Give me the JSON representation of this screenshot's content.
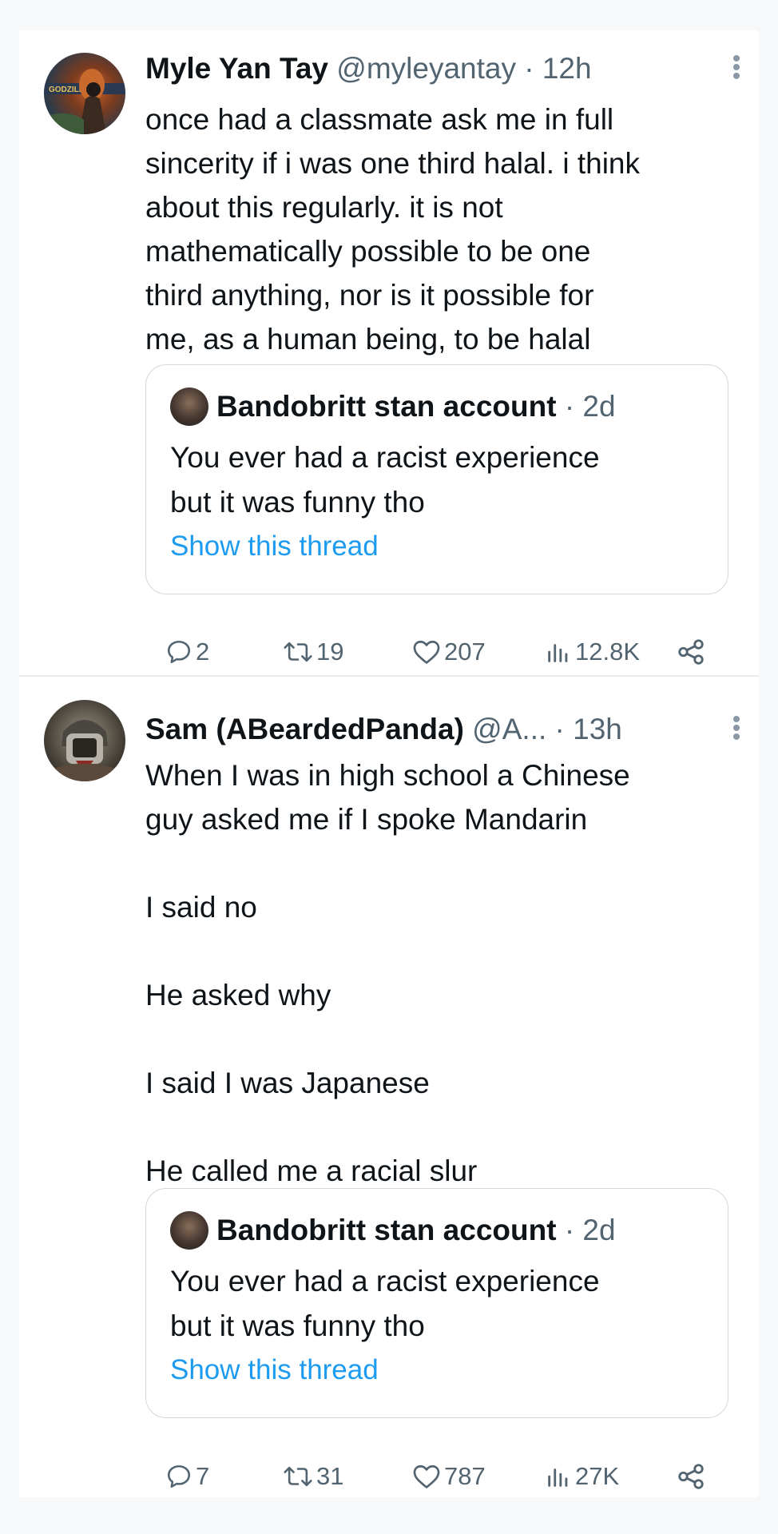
{
  "tweets": [
    {
      "name": "Myle Yan Tay",
      "handle": "@myleyantay",
      "time": "· 12h",
      "lines": [
        "once had a classmate ask me in full",
        "sincerity if i was one third halal. i think",
        "about this regularly. it is not",
        "mathematically possible to be one",
        "third anything, nor is it possible for",
        "me, as a human being, to be halal"
      ],
      "quote": {
        "name": "Bandobritt stan account",
        "time": "· 2d",
        "lines": [
          "You ever had a racist experience",
          "but it was funny tho"
        ],
        "link": "Show this thread"
      },
      "stats": {
        "replies": "2",
        "retweets": "19",
        "likes": "207",
        "views": "12.8K"
      }
    },
    {
      "name": "Sam (ABeardedPanda)",
      "handle": "@A...",
      "time": "· 13h",
      "paragraphs": [
        "When I was in high school a Chinese",
        "guy asked me if I spoke Mandarin",
        "",
        "I said no",
        "",
        "He asked why",
        "",
        "I said I was Japanese",
        "",
        "He called me a racial slur"
      ],
      "quote": {
        "name": "Bandobritt stan account",
        "time": "· 2d",
        "lines": [
          "You ever had a racist experience",
          "but it was funny tho"
        ],
        "link": "Show this thread"
      },
      "stats": {
        "replies": "7",
        "retweets": "31",
        "likes": "787",
        "views": "27K"
      }
    }
  ],
  "icons": [
    "more-icon",
    "reply-icon",
    "retweet-icon",
    "like-icon",
    "views-icon",
    "share-icon"
  ],
  "colors": {
    "text": "#0f1419",
    "secondary": "#536471",
    "link": "#1d9bf0",
    "border": "#cfd9de"
  }
}
